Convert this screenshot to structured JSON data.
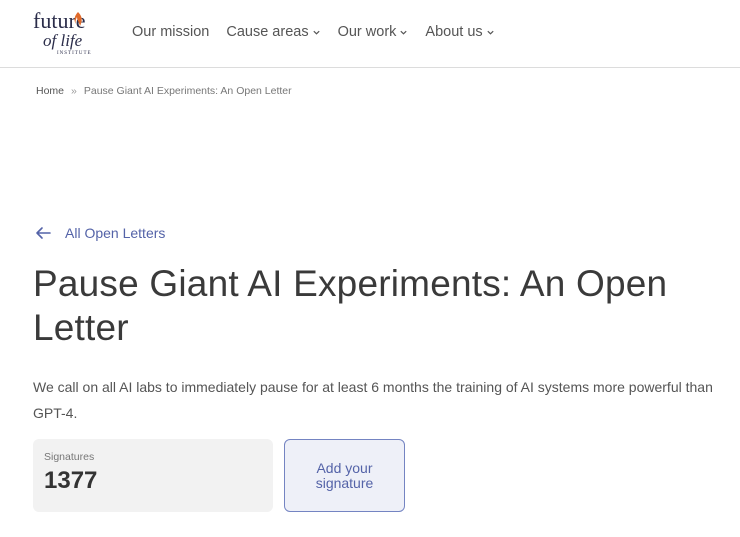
{
  "header": {
    "logo": {
      "line1": "future",
      "line2": "of life",
      "line3": "INSTITUTE",
      "flame_color": "#e06a2a"
    },
    "nav": [
      {
        "label": "Our mission",
        "has_dropdown": false
      },
      {
        "label": "Cause areas",
        "has_dropdown": true
      },
      {
        "label": "Our work",
        "has_dropdown": true
      },
      {
        "label": "About us",
        "has_dropdown": true
      }
    ]
  },
  "breadcrumb": {
    "home": "Home",
    "separator": "»",
    "current": "Pause Giant AI Experiments: An Open Letter"
  },
  "back_link": {
    "label": "All Open Letters",
    "icon": "arrow-left-icon"
  },
  "page": {
    "title": "Pause Giant AI Experiments: An Open Letter",
    "lead": "We call on all AI labs to immediately pause for at least 6 months the training of AI systems more powerful than GPT-4."
  },
  "signatures": {
    "label": "Signatures",
    "count": "1377",
    "add_button": "Add your signature"
  },
  "colors": {
    "accent": "#5463a8",
    "button_border": "#7484c2",
    "button_bg": "#eef0f8",
    "panel_bg": "#f2f2f2"
  }
}
